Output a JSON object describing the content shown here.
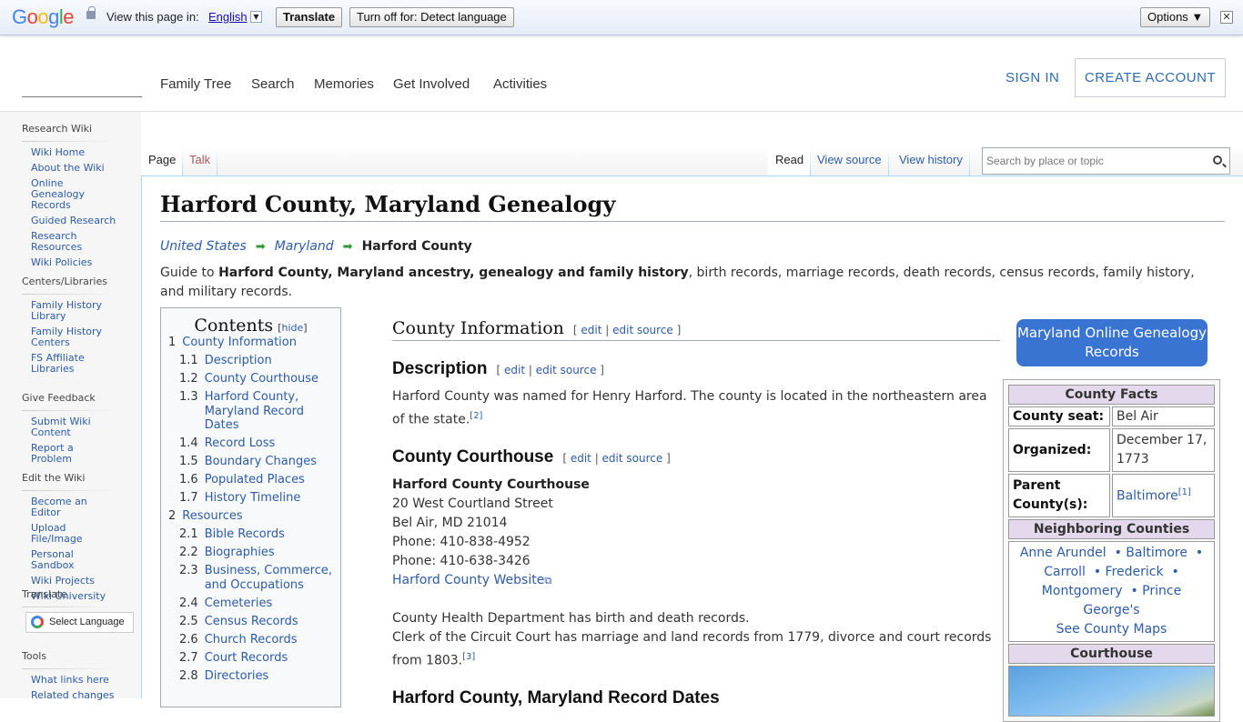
{
  "gtranslate": {
    "logo": "Google",
    "view_text": "View this page in:",
    "language": "English",
    "translate_btn": "Translate",
    "turnoff_btn": "Turn off for: Detect language",
    "options_btn": "Options ▼",
    "close": "✕"
  },
  "header": {
    "nav": [
      "Family Tree",
      "Search",
      "Memories",
      "Get Involved",
      "Activities"
    ],
    "sign_in": "SIGN IN",
    "create_account": "CREATE ACCOUNT"
  },
  "sidebar": {
    "sections": [
      {
        "heading": "Research Wiki",
        "items": [
          "Wiki Home",
          "About the Wiki",
          "Online Genealogy Records",
          "Guided Research",
          "Research Resources",
          "Wiki Policies"
        ]
      },
      {
        "heading": "Centers/Libraries",
        "items": [
          "Family History Library",
          "Family History Centers",
          "FS Affiliate Libraries"
        ]
      },
      {
        "heading": "Give Feedback",
        "items": [
          "Submit Wiki Content",
          "Report a Problem"
        ]
      },
      {
        "heading": "Edit the Wiki",
        "items": [
          "Become an Editor",
          "Upload File/Image",
          "Personal Sandbox",
          "Wiki Projects",
          "Wiki University"
        ]
      },
      {
        "heading": "Translate",
        "items": []
      },
      {
        "heading": "Tools",
        "items": [
          "What links here",
          "Related changes"
        ]
      }
    ],
    "select_language": "Select Language"
  },
  "tabs": {
    "page": "Page",
    "talk": "Talk",
    "read": "Read",
    "view_source": "View source",
    "view_history": "View history"
  },
  "search": {
    "placeholder": "Search by place or topic"
  },
  "article": {
    "title": "Harford County, Maryland Genealogy",
    "breadcrumb": [
      "United States",
      "Maryland",
      "Harford County"
    ],
    "intro_prefix": "Guide to ",
    "intro_bold": "Harford County, Maryland ancestry, genealogy and family history",
    "intro_suffix": ", birth records, marriage records, death records, census records, family history, and military records.",
    "edit": "edit",
    "edit_source": "edit source",
    "county_info_heading": "County Information",
    "description_heading": "Description",
    "description_text": "Harford County was named for Henry Harford. The county is located in the northeastern area of the state.",
    "description_ref": "[2]",
    "courthouse_heading": "County Courthouse",
    "courthouse_name": "Harford County Courthouse",
    "courthouse_lines": [
      "20 West Courtland Street",
      "Bel Air, MD 21014",
      "Phone: 410-838-4952",
      "Phone: 410-638-3426"
    ],
    "courthouse_link": "Harford County Website",
    "health_text": "County Health Department has birth and death records.",
    "clerk_text": "Clerk of the Circuit Court has marriage and land records from 1779, divorce and court records from 1803.",
    "clerk_ref": "[3]",
    "next_heading": "Harford County, Maryland Record Dates"
  },
  "toc": {
    "title": "Contents",
    "hide": "hide",
    "items": [
      {
        "num": "1",
        "label": "County Information",
        "level": 1
      },
      {
        "num": "1.1",
        "label": "Description",
        "level": 2
      },
      {
        "num": "1.2",
        "label": "County Courthouse",
        "level": 2
      },
      {
        "num": "1.3",
        "label": "Harford County, Maryland Record Dates",
        "level": 2
      },
      {
        "num": "1.4",
        "label": "Record Loss",
        "level": 2
      },
      {
        "num": "1.5",
        "label": "Boundary Changes",
        "level": 2
      },
      {
        "num": "1.6",
        "label": "Populated Places",
        "level": 2
      },
      {
        "num": "1.7",
        "label": "History Timeline",
        "level": 2
      },
      {
        "num": "2",
        "label": "Resources",
        "level": 1
      },
      {
        "num": "2.1",
        "label": "Bible Records",
        "level": 2
      },
      {
        "num": "2.2",
        "label": "Biographies",
        "level": 2
      },
      {
        "num": "2.3",
        "label": "Business, Commerce, and Occupations",
        "level": 2
      },
      {
        "num": "2.4",
        "label": "Cemeteries",
        "level": 2
      },
      {
        "num": "2.5",
        "label": "Census Records",
        "level": 2
      },
      {
        "num": "2.6",
        "label": "Church Records",
        "level": 2
      },
      {
        "num": "2.7",
        "label": "Court Records",
        "level": 2
      },
      {
        "num": "2.8",
        "label": "Directories",
        "level": 2
      }
    ]
  },
  "md_button": "Maryland Online Genealogy Records",
  "infobox": {
    "facts_heading": "County Facts",
    "seat_label": "County seat:",
    "seat_value": "Bel Air",
    "organized_label": "Organized:",
    "organized_value": "December 17, 1773",
    "parent_label": "Parent County(s):",
    "parent_value": "Baltimore",
    "parent_ref": "[1]",
    "neighbors_heading": "Neighboring Counties",
    "neighbors": [
      "Anne Arundel",
      "Baltimore",
      "Carroll",
      "Frederick",
      "Montgomery",
      "Prince George's"
    ],
    "see_maps": "See County Maps",
    "courthouse_heading": "Courthouse"
  }
}
